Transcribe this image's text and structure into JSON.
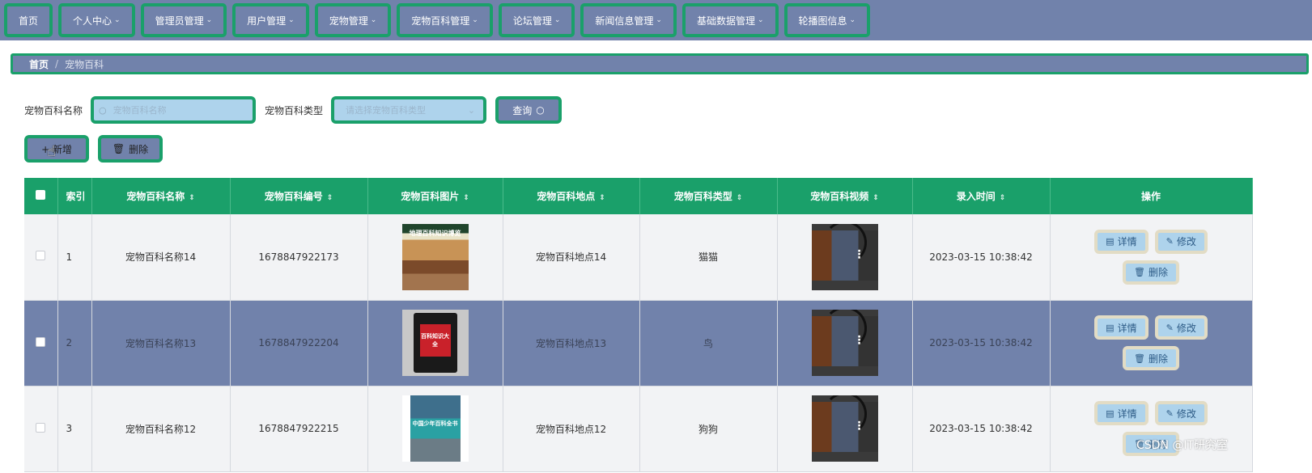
{
  "nav": [
    {
      "label": "首页",
      "dropdown": false
    },
    {
      "label": "个人中心",
      "dropdown": true
    },
    {
      "label": "管理员管理",
      "dropdown": true
    },
    {
      "label": "用户管理",
      "dropdown": true
    },
    {
      "label": "宠物管理",
      "dropdown": true
    },
    {
      "label": "宠物百科管理",
      "dropdown": true
    },
    {
      "label": "论坛管理",
      "dropdown": true
    },
    {
      "label": "新闻信息管理",
      "dropdown": true
    },
    {
      "label": "基础数据管理",
      "dropdown": true
    },
    {
      "label": "轮播图信息",
      "dropdown": true
    }
  ],
  "breadcrumb": {
    "home": "首页",
    "separator": "/",
    "current": "宠物百科"
  },
  "search": {
    "name_label": "宠物百科名称",
    "name_placeholder": "宠物百科名称",
    "type_label": "宠物百科类型",
    "type_placeholder": "请选择宠物百科类型",
    "query_label": "查询"
  },
  "actions": {
    "add_label": "+ 新增",
    "delete_label": "删除"
  },
  "table": {
    "columns": [
      "索引",
      "宠物百科名称",
      "宠物百科编号",
      "宠物百科图片",
      "宠物百科地点",
      "宠物百科类型",
      "宠物百科视频",
      "录入时间",
      "操作"
    ],
    "rows": [
      {
        "index": "1",
        "name": "宠物百科名称14",
        "code": "1678847922173",
        "image_title": "地理百科知识博览",
        "place": "宠物百科地点14",
        "type": "猫猫",
        "time": "2023-03-15 10:38:42"
      },
      {
        "index": "2",
        "name": "宠物百科名称13",
        "code": "1678847922204",
        "image_title": "百科知识大全",
        "place": "宠物百科地点13",
        "type": "鸟",
        "time": "2023-03-15 10:38:42"
      },
      {
        "index": "3",
        "name": "宠物百科名称12",
        "code": "1678847922215",
        "image_title": "中国少年百科全书",
        "place": "宠物百科地点12",
        "type": "狗狗",
        "time": "2023-03-15 10:38:42"
      }
    ],
    "row_buttons": {
      "detail": "详情",
      "edit": "修改",
      "delete": "删除"
    }
  },
  "watermark": "CSDN @IT研究室",
  "colors": {
    "nav_bg": "#7182ab",
    "accent": "#1aa06a",
    "input_bg": "#aed3ec",
    "row_highlight": "#7182ab"
  }
}
